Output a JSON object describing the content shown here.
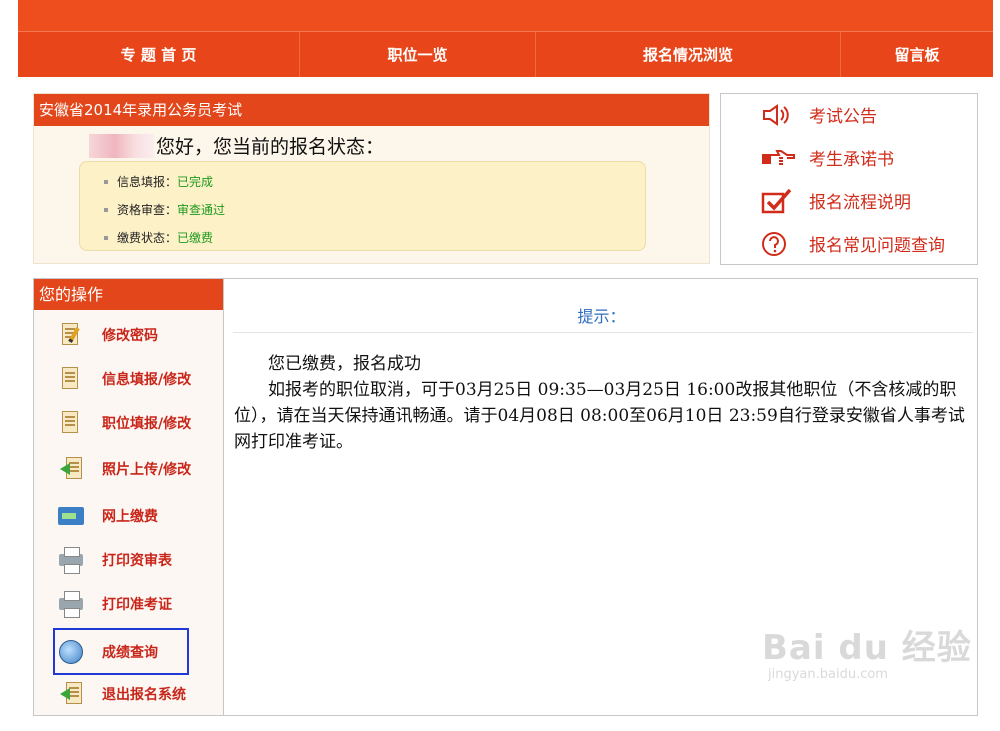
{
  "nav": {
    "items": [
      "专 题 首 页",
      "职位一览",
      "报名情况浏览",
      "留言板"
    ]
  },
  "status": {
    "title": "安徽省2014年录用公务员考试",
    "greeting": "您好，您当前的报名状态：",
    "rows": [
      {
        "label": "信息填报：",
        "value": "已完成"
      },
      {
        "label": "资格审查：",
        "value": "审查通过"
      },
      {
        "label": "缴费状态：",
        "value": "已缴费"
      }
    ]
  },
  "links": {
    "items": [
      {
        "label": "考试公告",
        "icon": "speaker-icon"
      },
      {
        "label": "考生承诺书",
        "icon": "pointing-hand-icon"
      },
      {
        "label": "报名流程说明",
        "icon": "checkbox-icon"
      },
      {
        "label": "报名常见问题查询",
        "icon": "question-icon"
      }
    ]
  },
  "operations": {
    "title": "您的操作",
    "items": [
      {
        "label": "修改密码",
        "icon": "edit-document-icon"
      },
      {
        "label": "信息填报/修改",
        "icon": "document-icon"
      },
      {
        "label": "职位填报/修改",
        "icon": "document-icon"
      },
      {
        "label": "照片上传/修改",
        "icon": "upload-icon"
      },
      {
        "label": "网上缴费",
        "icon": "payment-card-icon"
      },
      {
        "label": "打印资审表",
        "icon": "printer-icon"
      },
      {
        "label": "打印准考证",
        "icon": "printer-icon"
      },
      {
        "label": "成绩查询",
        "icon": "magnifier-icon"
      },
      {
        "label": "退出报名系统",
        "icon": "exit-icon"
      }
    ]
  },
  "content": {
    "hint": "提示：",
    "line1": "您已缴费，报名成功",
    "line2": "如报考的职位取消，可于03月25日 09:35—03月25日 16:00改报其他职位（不含核减的职位），请在当天保持通讯畅通。请于04月08日 08:00至06月10日 23:59自行登录安徽省人事考试网打印准考证。"
  },
  "watermark": {
    "logo": "Bai du 经验",
    "sub": "jingyan.baidu.com"
  },
  "colors": {
    "brand": "#e8461a",
    "link_red": "#d12b1a",
    "status_green": "#1e9a1e",
    "hint_blue": "#2e6dbf",
    "selection_border": "#1f38d6"
  }
}
